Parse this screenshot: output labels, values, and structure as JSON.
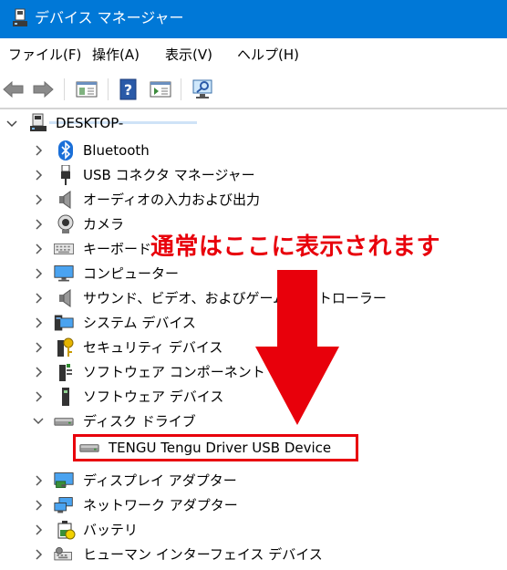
{
  "window": {
    "title": "デバイス マネージャー"
  },
  "menu": [
    "ファイル(F)",
    "操作(A)",
    "表示(V)",
    "ヘルプ(H)"
  ],
  "tree": {
    "root": "DESKTOP-",
    "categories": [
      {
        "label": "Bluetooth",
        "icon": "bluetooth-icon"
      },
      {
        "label": "USB コネクタ マネージャー",
        "icon": "usb-icon"
      },
      {
        "label": "オーディオの入力および出力",
        "icon": "speaker-icon"
      },
      {
        "label": "カメラ",
        "icon": "camera-icon"
      },
      {
        "label": "キーボード",
        "icon": "keyboard-icon"
      },
      {
        "label": "コンピューター",
        "icon": "monitor-icon"
      },
      {
        "label": "サウンド、ビデオ、およびゲーム コントローラー",
        "icon": "speaker-icon"
      },
      {
        "label": "システム デバイス",
        "icon": "system-icon"
      },
      {
        "label": "セキュリティ デバイス",
        "icon": "key-icon"
      },
      {
        "label": "ソフトウェア コンポーネント",
        "icon": "component-icon"
      },
      {
        "label": "ソフトウェア デバイス",
        "icon": "device-icon"
      },
      {
        "label": "ディスク ドライブ",
        "icon": "disk-drive-icon",
        "expanded": true
      },
      {
        "label": "ディスプレイ アダプター",
        "icon": "display-adapter-icon"
      },
      {
        "label": "ネットワーク アダプター",
        "icon": "network-icon"
      },
      {
        "label": "バッテリ",
        "icon": "battery-icon"
      },
      {
        "label": "ヒューマン インターフェイス デバイス",
        "icon": "hid-icon"
      }
    ],
    "disk_child": "TENGU Tengu Driver USB Device"
  },
  "annotation": {
    "text": "通常はここに表示されます",
    "color": "#e8000b"
  },
  "colors": {
    "titlebar": "#0078d7",
    "accent_red": "#e8000b"
  }
}
